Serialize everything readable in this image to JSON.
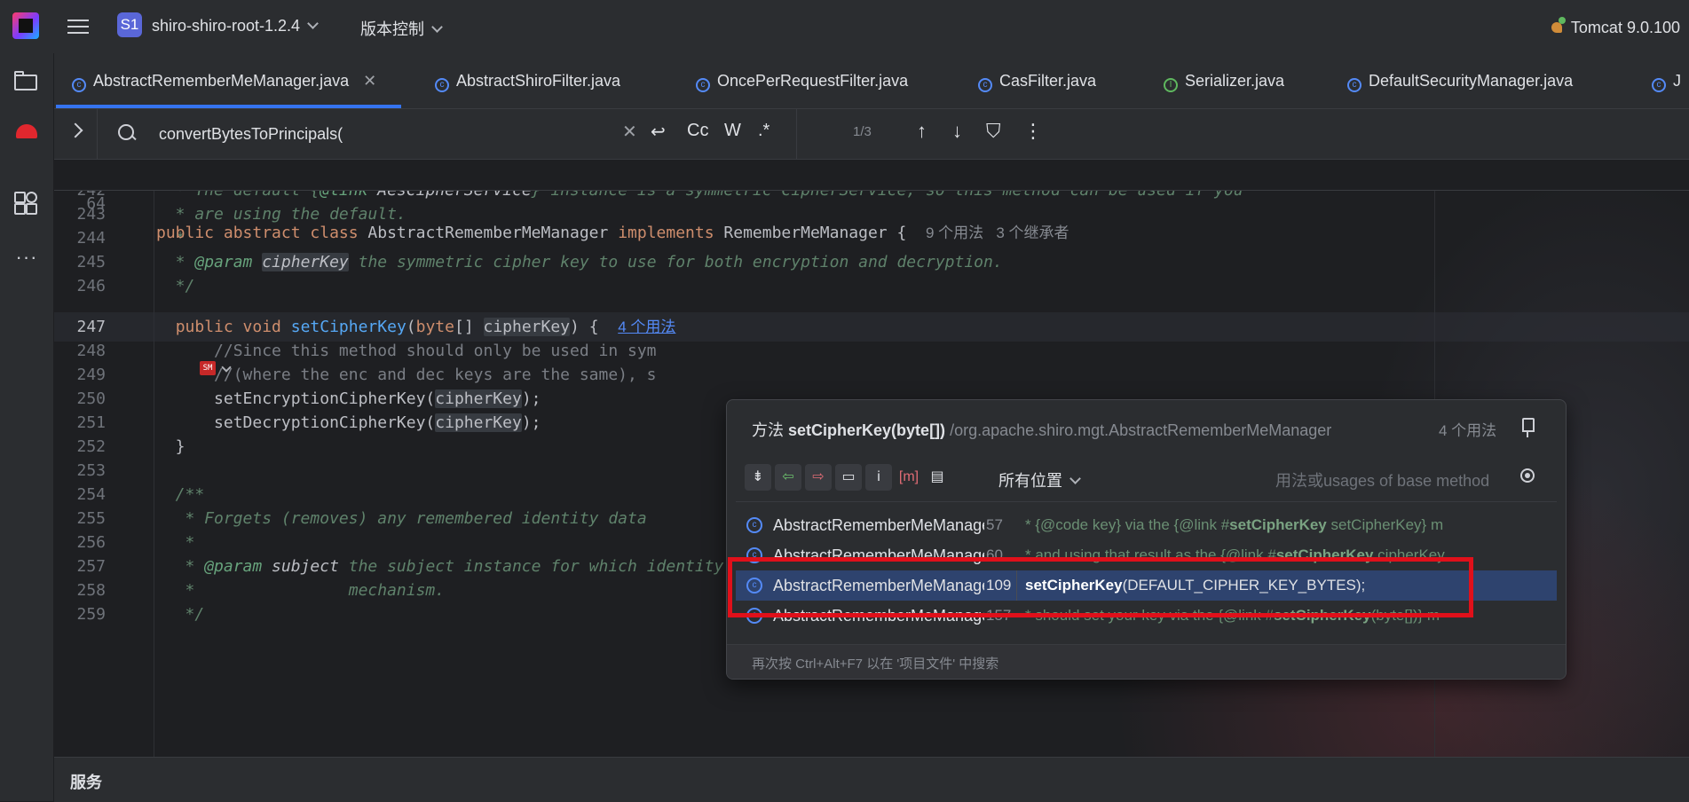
{
  "titlebar": {
    "project_badge": "S1",
    "project_name": "shiro-shiro-root-1.2.4",
    "vcs_label": "版本控制",
    "run_config": "Tomcat 9.0.100"
  },
  "tabs": [
    {
      "label": "AbstractRememberMeManager.java",
      "icon": "class-icon",
      "active": true
    },
    {
      "label": "AbstractShiroFilter.java",
      "icon": "class-icon"
    },
    {
      "label": "OncePerRequestFilter.java",
      "icon": "class-icon"
    },
    {
      "label": "CasFilter.java",
      "icon": "class-icon"
    },
    {
      "label": "Serializer.java",
      "icon": "interface-icon"
    },
    {
      "label": "DefaultSecurityManager.java",
      "icon": "class-icon"
    },
    {
      "label": "J",
      "icon": "class-icon"
    }
  ],
  "search": {
    "query": "convertBytesToPrincipals(",
    "opt_case": "Cc",
    "opt_word": "W",
    "opt_regex": ".*",
    "match_count": "1/3"
  },
  "editor": {
    "sticky_line_number": "64",
    "sticky_hints": "9 个用法   3 个继承者",
    "method_usages_hint": "4 个用法",
    "line_numbers": [
      "241",
      "242",
      "243",
      "244",
      "245",
      "246",
      "247",
      "248",
      "249",
      "250",
      "251",
      "252",
      "253",
      "254",
      "255",
      "256",
      "257",
      "258",
      "259"
    ]
  },
  "popup": {
    "title_prefix": "方法",
    "title_method": "setCipherKey(byte[])",
    "title_path": "/org.apache.shiro.mgt.AbstractRememberMeManager",
    "usage_count": "4 个用法",
    "scope_label": "所有位置",
    "filter_placeholder": "用法或usages of base method",
    "usages": [
      {
        "file": "AbstractRememberMeManager.java",
        "line": "57",
        "text_before": "* {@code key} via the {@link #",
        "match": "setCipherKey",
        "text_after": " setCipherKey} m"
      },
      {
        "file": "AbstractRememberMeManager.java",
        "line": "60",
        "text_before": "* and using that result as the {@link #",
        "match": "setCipherKey",
        "text_after": " cipherKey"
      },
      {
        "file": "AbstractRememberMeManager.java",
        "line": "109",
        "text_before": "",
        "match": "setCipherKey",
        "text_after": "(DEFAULT_CIPHER_KEY_BYTES);",
        "selected": true
      },
      {
        "file": "AbstractRememberMeManager.java",
        "line": "157",
        "text_before": "* should set your key via the {@link #",
        "match": "setCipherKey",
        "text_after": "(byte[])} m"
      }
    ],
    "footer": "再次按 Ctrl+Alt+F7 以在 '项目文件' 中搜索"
  },
  "bottom_panel": "服务",
  "colors": {
    "accent": "#3574f0",
    "highlight_box": "#e0101a",
    "selected_row": "#2e436e"
  }
}
